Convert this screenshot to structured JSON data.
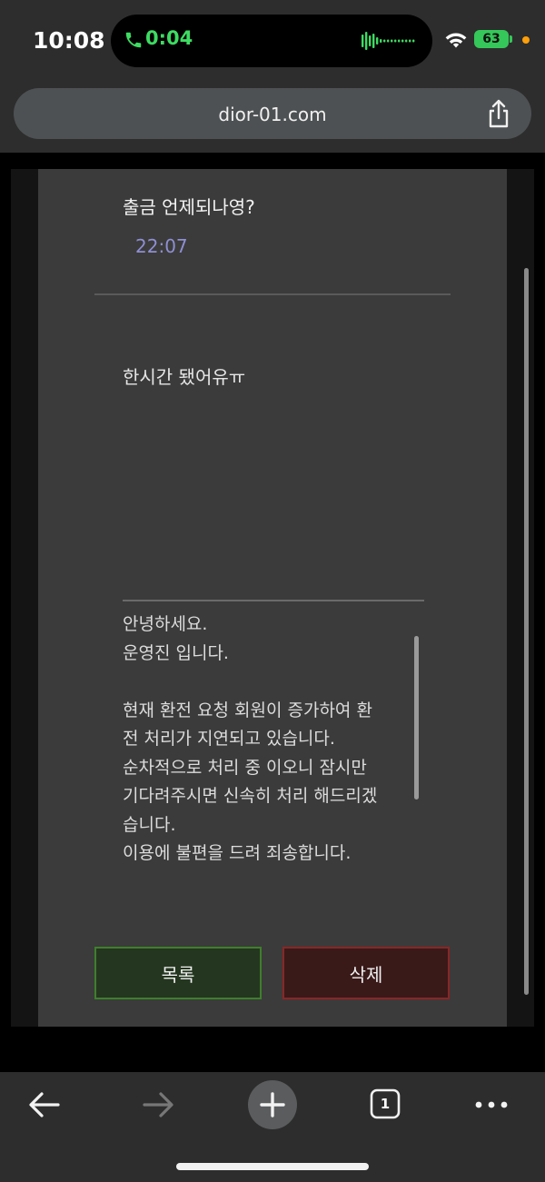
{
  "status_bar": {
    "time": "10:08",
    "call_time": "0:04",
    "battery": "63"
  },
  "browser": {
    "url": "dior-01.com",
    "tabs_count": "1"
  },
  "inquiry": {
    "question": "출금 언제되나영?",
    "question_time": "22:07",
    "reply": "한시간 됐어유ㅠ"
  },
  "answer": {
    "lines": [
      "안녕하세요.",
      "운영진 입니다.",
      "",
      "현재 환전 요청 회원이 증가하여 환",
      "전 처리가 지연되고 있습니다.",
      "순차적으로 처리 중 이오니 잠시만",
      "기다려주시면 신속히 처리 해드리겠",
      "습니다.",
      "이용에 불편을 드려 죄송합니다."
    ]
  },
  "buttons": {
    "list_label": "목록",
    "delete_label": "삭제"
  },
  "colors": {
    "list_button_bg": "#24361f",
    "delete_button_bg": "#3a1919",
    "timestamp": "#8e8fd2",
    "call_green": "#3ddc62"
  },
  "icons": {
    "call": "phone-icon",
    "audio": "waveform-icon",
    "wifi": "wifi-icon",
    "share": "share-icon",
    "back": "arrow-left-icon",
    "forward": "arrow-right-icon",
    "new_tab": "plus-icon",
    "tabs": "tabs-icon",
    "more": "more-dots-icon"
  }
}
